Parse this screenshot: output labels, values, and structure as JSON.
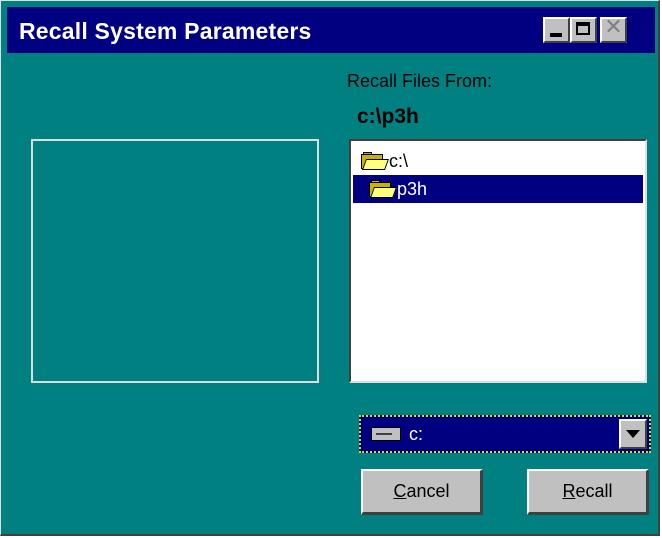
{
  "window": {
    "title": "Recall System Parameters",
    "close_glyph": "✕"
  },
  "recall": {
    "label": "Recall Files From:",
    "current_path": "c:\\p3h"
  },
  "directories": [
    {
      "name": "c:\\",
      "icon": "open-folder-icon",
      "selected": false
    },
    {
      "name": "p3h",
      "icon": "open-folder-icon",
      "selected": true
    }
  ],
  "drive": {
    "value": "c:",
    "icon": "drive-icon"
  },
  "buttons": {
    "cancel_mnemonic": "C",
    "cancel_rest": "ancel",
    "recall_mnemonic": "R",
    "recall_rest": "ecall"
  },
  "colors": {
    "background": "#008080",
    "titlebar": "#000080",
    "selection": "#000080",
    "button_face": "#c0c0c0"
  }
}
